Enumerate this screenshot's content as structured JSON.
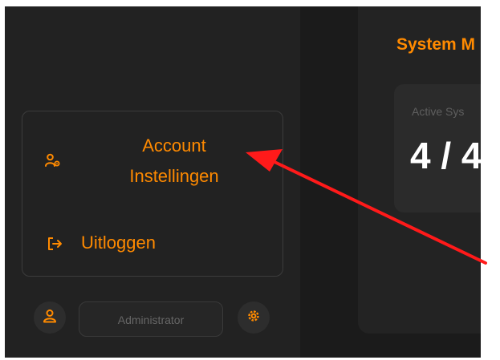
{
  "main": {
    "section_title": "System M",
    "stat_card": {
      "label": "Active Sys",
      "value": "4 / 4"
    }
  },
  "menu": {
    "account_label_line1": "Account",
    "account_label_line2": "Instellingen",
    "logout_label": "Uitloggen"
  },
  "footer": {
    "role": "Administrator"
  },
  "colors": {
    "accent": "#ff8a00",
    "background": "#1e1e1e",
    "annotation_arrow": "#ff1a1a"
  },
  "icons": [
    "user-cog-icon",
    "logout-icon",
    "user-icon",
    "gear-icon"
  ]
}
